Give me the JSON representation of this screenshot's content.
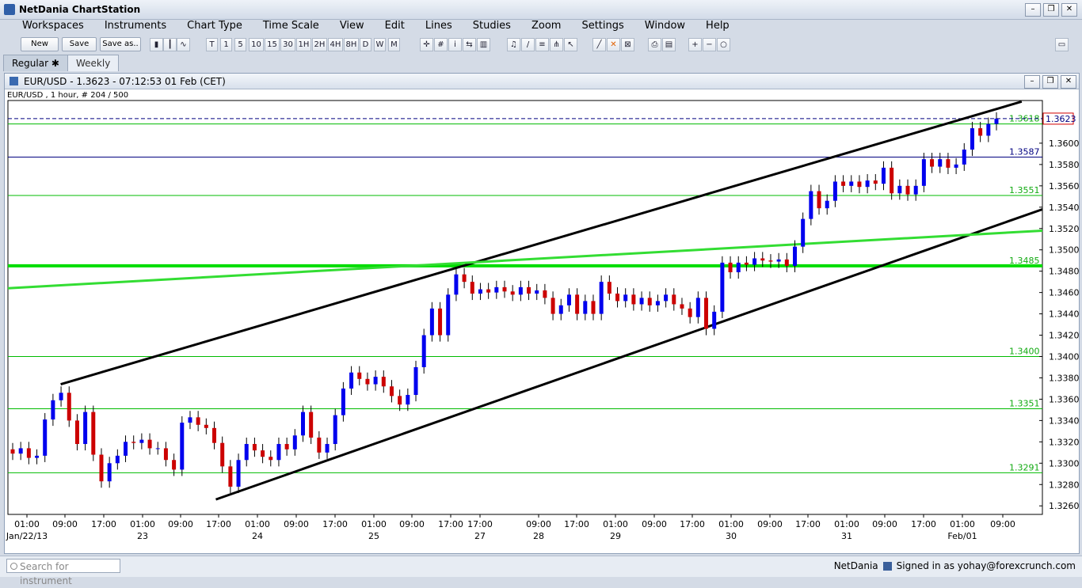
{
  "app": {
    "title": "NetDania ChartStation"
  },
  "menu": [
    "Workspaces",
    "Instruments",
    "Chart Type",
    "Time Scale",
    "View",
    "Edit",
    "Lines",
    "Studies",
    "Zoom",
    "Settings",
    "Window",
    "Help"
  ],
  "toolbar": {
    "buttons": [
      "New",
      "Save",
      "Save as.."
    ],
    "timeframes": [
      "T",
      "1",
      "5",
      "10",
      "15",
      "30",
      "1H",
      "2H",
      "4H",
      "8H",
      "D",
      "W",
      "M"
    ],
    "tool_icons": [
      "bar-chart",
      "candles-chart",
      "line-chart",
      "crosshair",
      "grid",
      "info",
      "arrows",
      "volume",
      "bell",
      "trendline",
      "fibonacci",
      "pitchfork",
      "cursor",
      "draw-line",
      "delete-cross",
      "delete-all",
      "print",
      "print-preview",
      "zoom-in",
      "zoom-out",
      "zoom-reset"
    ]
  },
  "tabs": [
    {
      "label": "Regular",
      "active": true
    },
    {
      "label": "Weekly",
      "active": false
    }
  ],
  "chart_window": {
    "title": "EUR/USD - 1.3623 - 07:12:53  01 Feb (CET)",
    "info": "EUR/USD , 1 hour, # 204 / 500"
  },
  "chart_data": {
    "type": "candlestick",
    "instrument": "EUR/USD",
    "interval": "1 hour",
    "last_price": "1.3623",
    "ylim": [
      1.3252,
      1.364
    ],
    "y_ticks": [
      "1.3260",
      "1.3280",
      "1.3300",
      "1.3320",
      "1.3340",
      "1.3360",
      "1.3380",
      "1.3400",
      "1.3420",
      "1.3440",
      "1.3460",
      "1.3480",
      "1.3500",
      "1.3520",
      "1.3540",
      "1.3560",
      "1.3580",
      "1.3600"
    ],
    "x_ticks": [
      {
        "time": "01:00",
        "date": "Jan/22/13"
      },
      {
        "time": "09:00",
        "date": ""
      },
      {
        "time": "17:00",
        "date": ""
      },
      {
        "time": "01:00",
        "date": "23"
      },
      {
        "time": "09:00",
        "date": ""
      },
      {
        "time": "17:00",
        "date": ""
      },
      {
        "time": "01:00",
        "date": "24"
      },
      {
        "time": "09:00",
        "date": ""
      },
      {
        "time": "17:00",
        "date": ""
      },
      {
        "time": "01:00",
        "date": "25"
      },
      {
        "time": "09:00",
        "date": ""
      },
      {
        "time": "17:00",
        "date": ""
      },
      {
        "time": "17:00",
        "date": "27"
      },
      {
        "time": "09:00",
        "date": "28"
      },
      {
        "time": "17:00",
        "date": ""
      },
      {
        "time": "01:00",
        "date": "29"
      },
      {
        "time": "09:00",
        "date": ""
      },
      {
        "time": "17:00",
        "date": ""
      },
      {
        "time": "01:00",
        "date": "30"
      },
      {
        "time": "09:00",
        "date": ""
      },
      {
        "time": "17:00",
        "date": ""
      },
      {
        "time": "01:00",
        "date": "31"
      },
      {
        "time": "09:00",
        "date": ""
      },
      {
        "time": "17:00",
        "date": ""
      },
      {
        "time": "01:00",
        "date": "Feb/01"
      },
      {
        "time": "09:00",
        "date": ""
      }
    ],
    "horizontal_levels": [
      {
        "value": 1.3618,
        "label": "1.3618",
        "color": "#00bb00",
        "style": "solid"
      },
      {
        "value": 1.3587,
        "label": "1.3587",
        "color": "#000080",
        "style": "solid"
      },
      {
        "value": 1.3551,
        "label": "1.3551",
        "color": "#00bb00",
        "style": "solid"
      },
      {
        "value": 1.3485,
        "label": "1.3485",
        "color": "#00dd00",
        "style": "thick"
      },
      {
        "value": 1.34,
        "label": "1.3400",
        "color": "#00bb00",
        "style": "solid"
      },
      {
        "value": 1.3351,
        "label": "1.3351",
        "color": "#00bb00",
        "style": "solid"
      },
      {
        "value": 1.3291,
        "label": "1.3291",
        "color": "#00bb00",
        "style": "solid"
      },
      {
        "value": 1.3623,
        "label": "1.3623",
        "color": "#000080",
        "style": "dashed"
      }
    ],
    "trendlines": [
      {
        "name": "channel-upper",
        "from": [
          0.051,
          1.3374
        ],
        "to": [
          0.98,
          1.3639
        ],
        "color": "#000000"
      },
      {
        "name": "channel-lower",
        "from": [
          0.201,
          1.3266
        ],
        "to": [
          1.0,
          1.3538
        ],
        "color": "#000000"
      },
      {
        "name": "green-trend",
        "from": [
          0.0,
          1.3464
        ],
        "to": [
          1.0,
          1.3518
        ],
        "color": "#33dd33"
      }
    ],
    "candles": [
      [
        1.3313,
        1.3309
      ],
      [
        1.3309,
        1.3314
      ],
      [
        1.3314,
        1.3305
      ],
      [
        1.3305,
        1.3307
      ],
      [
        1.3307,
        1.3341
      ],
      [
        1.3341,
        1.3359
      ],
      [
        1.3359,
        1.3366
      ],
      [
        1.3366,
        1.334
      ],
      [
        1.334,
        1.3318
      ],
      [
        1.3318,
        1.3348
      ],
      [
        1.3348,
        1.3308
      ],
      [
        1.3308,
        1.3283
      ],
      [
        1.3283,
        1.33
      ],
      [
        1.33,
        1.3307
      ],
      [
        1.3307,
        1.332
      ],
      [
        1.332,
        1.3319
      ],
      [
        1.3319,
        1.3322
      ],
      [
        1.3322,
        1.3314
      ],
      [
        1.3314,
        1.3314
      ],
      [
        1.3314,
        1.3303
      ],
      [
        1.3303,
        1.3294
      ],
      [
        1.3294,
        1.3338
      ],
      [
        1.3338,
        1.3343
      ],
      [
        1.3343,
        1.3336
      ],
      [
        1.3336,
        1.3333
      ],
      [
        1.3333,
        1.3319
      ],
      [
        1.3319,
        1.3297
      ],
      [
        1.3297,
        1.3278
      ],
      [
        1.3278,
        1.3303
      ],
      [
        1.3303,
        1.3318
      ],
      [
        1.3318,
        1.3312
      ],
      [
        1.3312,
        1.3306
      ],
      [
        1.3306,
        1.3303
      ],
      [
        1.3303,
        1.3318
      ],
      [
        1.3318,
        1.3313
      ],
      [
        1.3313,
        1.3326
      ],
      [
        1.3326,
        1.3348
      ],
      [
        1.3348,
        1.3324
      ],
      [
        1.3324,
        1.331
      ],
      [
        1.331,
        1.3318
      ],
      [
        1.3318,
        1.3345
      ],
      [
        1.3345,
        1.337
      ],
      [
        1.337,
        1.3385
      ],
      [
        1.3385,
        1.3379
      ],
      [
        1.3379,
        1.3374
      ],
      [
        1.3374,
        1.3381
      ],
      [
        1.3381,
        1.3372
      ],
      [
        1.3372,
        1.3363
      ],
      [
        1.3363,
        1.3355
      ],
      [
        1.3355,
        1.3364
      ],
      [
        1.3364,
        1.339
      ],
      [
        1.339,
        1.342
      ],
      [
        1.342,
        1.3445
      ],
      [
        1.3445,
        1.342
      ],
      [
        1.342,
        1.3458
      ],
      [
        1.3458,
        1.3477
      ],
      [
        1.3477,
        1.347
      ],
      [
        1.347,
        1.3459
      ],
      [
        1.3459,
        1.3463
      ],
      [
        1.3463,
        1.346
      ],
      [
        1.346,
        1.3465
      ],
      [
        1.3465,
        1.3461
      ],
      [
        1.3461,
        1.3458
      ],
      [
        1.3458,
        1.3465
      ],
      [
        1.3465,
        1.3459
      ],
      [
        1.3459,
        1.3462
      ],
      [
        1.3462,
        1.3455
      ],
      [
        1.3455,
        1.344
      ],
      [
        1.344,
        1.3448
      ],
      [
        1.3448,
        1.3458
      ],
      [
        1.3458,
        1.344
      ],
      [
        1.344,
        1.3452
      ],
      [
        1.3452,
        1.344
      ],
      [
        1.344,
        1.347
      ],
      [
        1.347,
        1.3459
      ],
      [
        1.3459,
        1.3452
      ],
      [
        1.3452,
        1.3458
      ],
      [
        1.3458,
        1.3449
      ],
      [
        1.3449,
        1.3455
      ],
      [
        1.3455,
        1.3448
      ],
      [
        1.3448,
        1.3452
      ],
      [
        1.3452,
        1.3458
      ],
      [
        1.3458,
        1.3449
      ],
      [
        1.3449,
        1.3445
      ],
      [
        1.3445,
        1.3437
      ],
      [
        1.3437,
        1.3455
      ],
      [
        1.3455,
        1.3426
      ],
      [
        1.3426,
        1.3442
      ],
      [
        1.3442,
        1.3488
      ],
      [
        1.3488,
        1.3479
      ],
      [
        1.3479,
        1.3488
      ],
      [
        1.3488,
        1.3486
      ],
      [
        1.3486,
        1.3492
      ],
      [
        1.3492,
        1.349
      ],
      [
        1.349,
        1.3489
      ],
      [
        1.3489,
        1.3491
      ],
      [
        1.3491,
        1.3485
      ],
      [
        1.3485,
        1.3503
      ],
      [
        1.3503,
        1.3529
      ],
      [
        1.3529,
        1.3555
      ],
      [
        1.3555,
        1.3539
      ],
      [
        1.3539,
        1.3546
      ],
      [
        1.3546,
        1.3564
      ],
      [
        1.3564,
        1.356
      ],
      [
        1.356,
        1.3564
      ],
      [
        1.3564,
        1.3559
      ],
      [
        1.3559,
        1.3565
      ],
      [
        1.3565,
        1.3562
      ],
      [
        1.3562,
        1.3577
      ],
      [
        1.3577,
        1.3553
      ],
      [
        1.3553,
        1.356
      ],
      [
        1.356,
        1.3552
      ],
      [
        1.3552,
        1.356
      ],
      [
        1.356,
        1.3585
      ],
      [
        1.3585,
        1.3578
      ],
      [
        1.3578,
        1.3585
      ],
      [
        1.3585,
        1.3577
      ],
      [
        1.3577,
        1.358
      ],
      [
        1.358,
        1.3594
      ],
      [
        1.3594,
        1.3614
      ],
      [
        1.3614,
        1.3607
      ],
      [
        1.3607,
        1.3618
      ],
      [
        1.3618,
        1.3623
      ]
    ]
  },
  "status": {
    "search_placeholder": "Search for instrument",
    "brand": "NetDania",
    "signed": "Signed in as yohay@forexcrunch.com"
  }
}
